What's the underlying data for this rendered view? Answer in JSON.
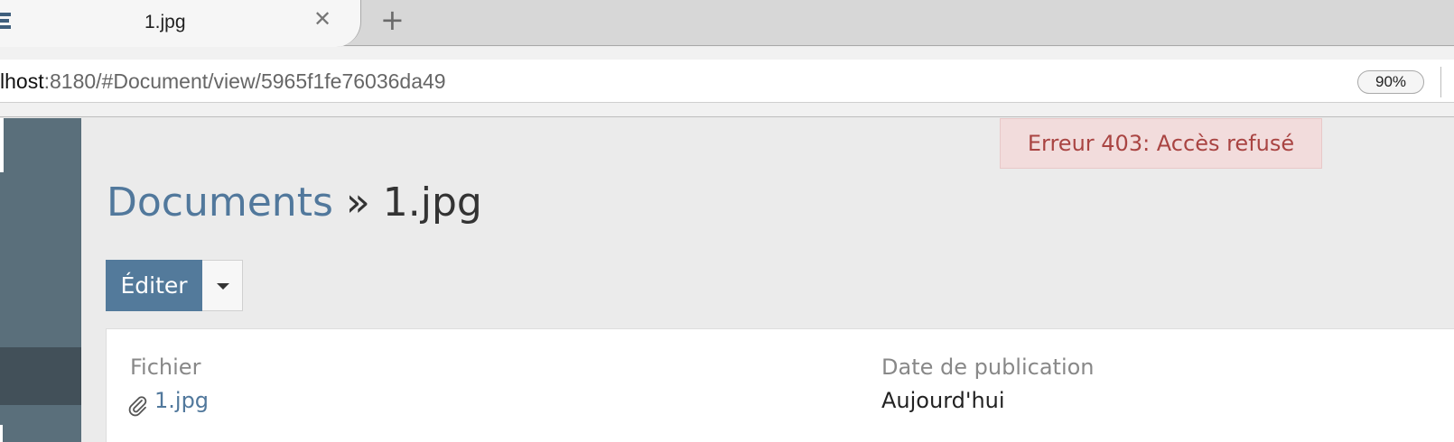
{
  "browser": {
    "tab_title": "1.jpg",
    "tab_close": "✕",
    "new_tab": "+",
    "url_host": "lhost",
    "url_rest": ":8180/#Document/view/5965f1fe76036da49",
    "zoom": "90%"
  },
  "alert": {
    "text": "Erreur 403: Accès refusé"
  },
  "header": {
    "breadcrumb_link": "Documents",
    "separator": " » ",
    "title": "1.jpg"
  },
  "actions": {
    "edit_label": "Éditer"
  },
  "panel": {
    "file_label": "Fichier",
    "file_name": "1.jpg",
    "date_label": "Date de publication",
    "date_value": "Aujourd'hui"
  },
  "colors": {
    "sidebar": "#5a6f7b",
    "sidebar_active": "#425059",
    "primary": "#537a9b",
    "link": "#51789c",
    "alert_bg": "#f2dcdc",
    "alert_text": "#a94442"
  },
  "icons": {
    "favicon": "app-logo-icon",
    "caret": "caret-down-icon",
    "attachment": "paperclip-icon"
  }
}
